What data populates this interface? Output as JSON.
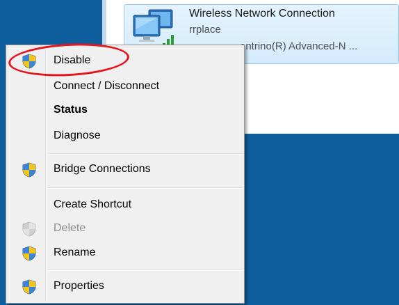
{
  "connection": {
    "name": "Wireless Network Connection",
    "network": "rrplace",
    "adapter": "entrino(R) Advanced-N ..."
  },
  "menu": {
    "items": [
      {
        "label": "Disable",
        "icon": "uac-shield-icon",
        "bold": false,
        "disabled": false
      },
      {
        "label": "Connect / Disconnect",
        "icon": null,
        "bold": false,
        "disabled": false
      },
      {
        "label": "Status",
        "icon": null,
        "bold": true,
        "disabled": false
      },
      {
        "label": "Diagnose",
        "icon": null,
        "bold": false,
        "disabled": false
      },
      {
        "label": "Bridge Connections",
        "icon": "uac-shield-icon",
        "bold": false,
        "disabled": false
      },
      {
        "label": "Create Shortcut",
        "icon": null,
        "bold": false,
        "disabled": false
      },
      {
        "label": "Delete",
        "icon": "uac-shield-icon",
        "bold": false,
        "disabled": true
      },
      {
        "label": "Rename",
        "icon": "uac-shield-icon",
        "bold": false,
        "disabled": false
      },
      {
        "label": "Properties",
        "icon": "uac-shield-icon",
        "bold": false,
        "disabled": false
      }
    ]
  },
  "colors": {
    "desktop": "#0f5f9f",
    "highlight_annotation": "#e8141c",
    "menu_background": "#f0f0f0",
    "disabled_text": "#8d8d8d"
  }
}
